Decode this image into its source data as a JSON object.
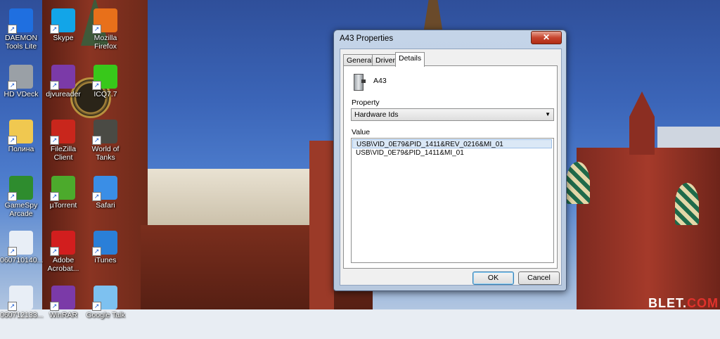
{
  "desktop": {
    "icons": [
      {
        "label": "DAEMON\nTools Lite",
        "icon": "daemon-tools-icon",
        "color": "#1f6fe0"
      },
      {
        "label": "Skype",
        "icon": "skype-icon",
        "color": "#12a5e8"
      },
      {
        "label": "Mozilla\nFirefox",
        "icon": "firefox-icon",
        "color": "#e8701a"
      },
      {
        "label": "HD VDeck",
        "icon": "hd-vdeck-icon",
        "color": "#9aa0a6"
      },
      {
        "label": "djvureader",
        "icon": "djvureader-icon",
        "color": "#7b3aa8"
      },
      {
        "label": "ICQ7.7",
        "icon": "icq-icon",
        "color": "#38c81a"
      },
      {
        "label": "Полина",
        "icon": "folder-icon",
        "color": "#f0c850"
      },
      {
        "label": "FileZilla\nClient",
        "icon": "filezilla-icon",
        "color": "#c9261c"
      },
      {
        "label": "World of\nTanks",
        "icon": "world-of-tanks-icon",
        "color": "#4a4a44"
      },
      {
        "label": "GameSpy\nArcade",
        "icon": "gamespy-icon",
        "color": "#2e8c2e"
      },
      {
        "label": "µTorrent",
        "icon": "utorrent-icon",
        "color": "#4caa2c"
      },
      {
        "label": "Safari",
        "icon": "safari-icon",
        "color": "#3a8ee6"
      },
      {
        "label": "060710140...",
        "icon": "3gpp-file-icon",
        "color": "#e8eef6"
      },
      {
        "label": "Adobe\nAcrobat...",
        "icon": "adobe-acrobat-icon",
        "color": "#d21e1e"
      },
      {
        "label": "iTunes",
        "icon": "itunes-icon",
        "color": "#2a7fd8"
      },
      {
        "label": "060712133...",
        "icon": "3gpp-file-icon",
        "color": "#e8eef6"
      },
      {
        "label": "WinRAR",
        "icon": "winrar-icon",
        "color": "#7b3aa8"
      },
      {
        "label": "Google Talk",
        "icon": "google-talk-icon",
        "color": "#7dc1f0"
      }
    ],
    "watermark": {
      "text_a": "BLET.",
      "text_b": "COM"
    }
  },
  "dialog": {
    "title": "A43 Properties",
    "close_label": "✕",
    "tabs": [
      {
        "label": "General"
      },
      {
        "label": "Driver"
      },
      {
        "label": "Details"
      }
    ],
    "active_tab": "Details",
    "device_name": "A43",
    "property_label": "Property",
    "property_value": "Hardware Ids",
    "value_label": "Value",
    "values": [
      "USB\\VID_0E79&PID_1411&REV_0216&MI_01",
      "USB\\VID_0E79&PID_1411&MI_01"
    ],
    "ok_label": "OK",
    "cancel_label": "Cancel"
  }
}
